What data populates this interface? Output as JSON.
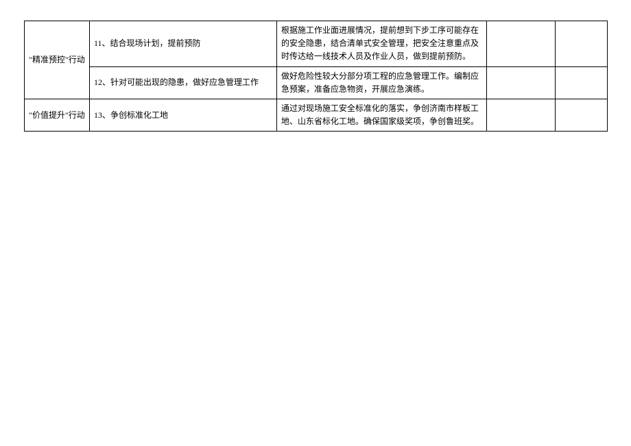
{
  "table": {
    "rows": [
      {
        "category": "\"精准预控\"行动",
        "item": "11、结合现场计划，提前预防",
        "desc": "根据施工作业面进展情况，提前想到下步工序可能存在的安全隐患，结合清单式安全管理，把安全注意重点及时传达给一线技术人员及作业人员，做到提前预防。"
      },
      {
        "item": "12、针对可能出现的隐患，做好应急管理工作",
        "desc": "做好危险性较大分部分项工程的应急管理工作。编制应急预案，准备应急物资，开展应急演练。"
      },
      {
        "category": "\"价值提升\"行动",
        "item": "13、争创标准化工地",
        "desc": "通过对现场施工安全标准化的落实，争创济南市样板工地、山东省标化工地。确保国家级奖项，争创鲁班奖。"
      }
    ]
  }
}
